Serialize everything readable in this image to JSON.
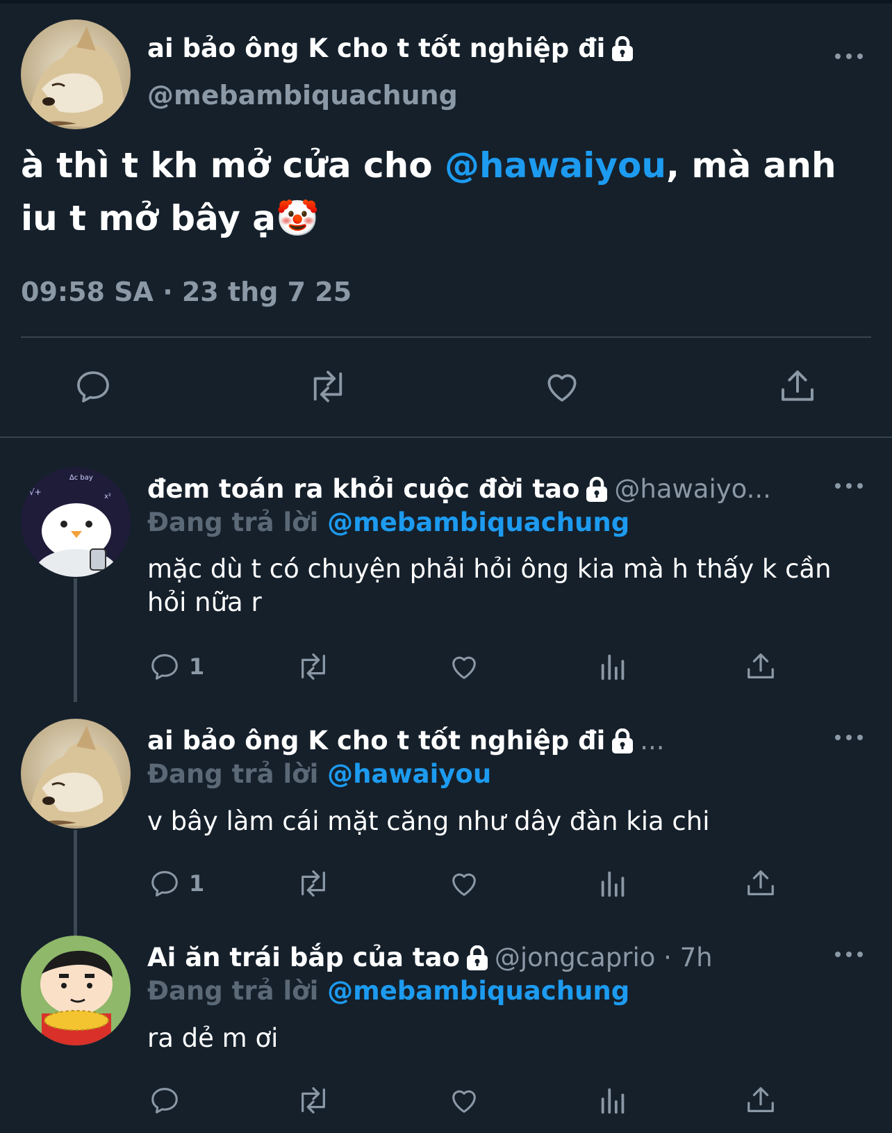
{
  "main_tweet": {
    "display_name": "ai bảo ông K cho t tốt nghiệp đi",
    "handle": "@mebambiquachung",
    "text_before": "à thì t kh mở cửa cho ",
    "mention": "@hawaiyou",
    "text_after": ", mà anh iu t mở bây ạ🤡",
    "timestamp": "09:58 SA · 23 thg 7 25",
    "actions": [
      "reply-icon",
      "retweet-icon",
      "like-icon",
      "share-icon"
    ]
  },
  "replies": [
    {
      "display_name": "đem toán ra khỏi cuộc đời tao",
      "handle": "@hawaiyo...",
      "reply_prefix": "Đang trả lời ",
      "reply_to": "@mebambiquachung",
      "text": "mặc dù t có chuyện phải hỏi ông kia mà h thấy k cần hỏi nữa r",
      "reply_count": "1"
    },
    {
      "display_name": "ai bảo ông K cho t tốt nghiệp đi",
      "handle": "...",
      "reply_prefix": "Đang trả lời ",
      "reply_to": "@hawaiyou",
      "text": "v bây làm cái mặt căng như dây đàn kia chi",
      "reply_count": "1"
    },
    {
      "display_name": "Ai ăn trái bắp của tao",
      "handle": "@jongcaprio · 7h",
      "reply_prefix": "Đang trả lời ",
      "reply_to": "@mebambiquachung",
      "text": "ra dẻ m ơi",
      "reply_count": ""
    }
  ],
  "colors": {
    "background": "#15202b",
    "accent": "#1d9bf0",
    "secondary_text": "#8b98a5",
    "divider": "#38444d"
  }
}
